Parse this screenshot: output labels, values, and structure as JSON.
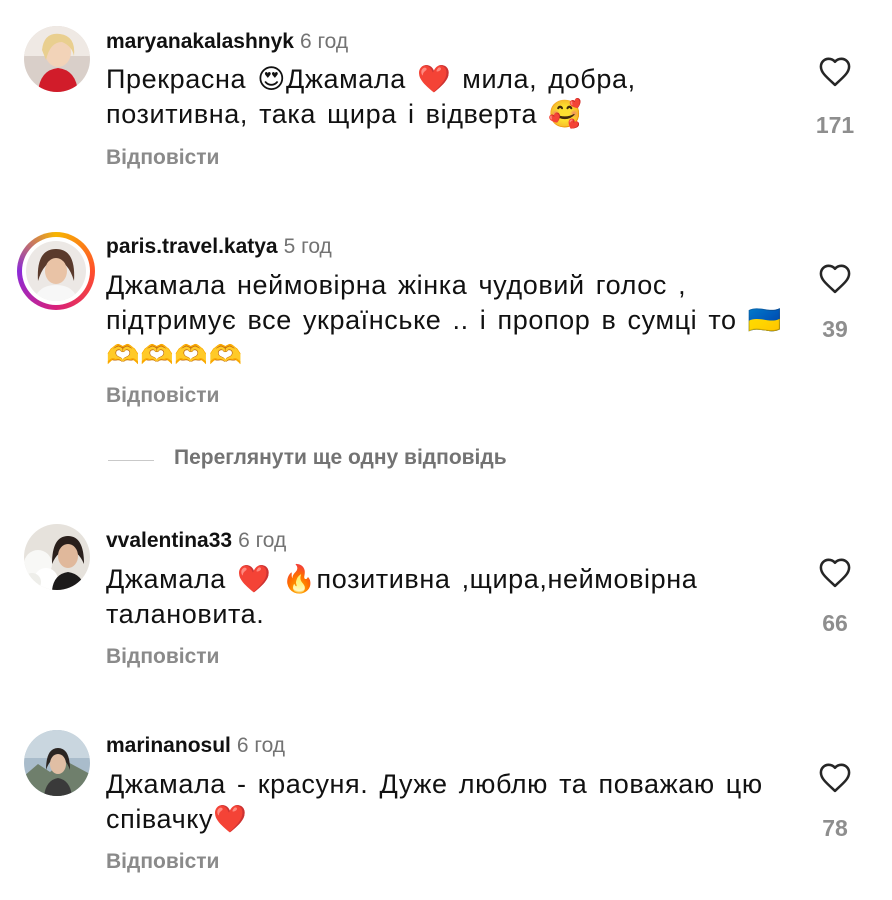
{
  "colors": {
    "background": "#ffffff",
    "username": "#111111",
    "meta": "#737373",
    "reply": "#8a8a8a",
    "like_count": "#8e8e8e",
    "heart_emoji": "#e0202f",
    "story_ring": [
      "#f7b500",
      "#ff4f2b",
      "#d8207a",
      "#8b2bd8"
    ]
  },
  "icons": {
    "like": "heart-outline-icon",
    "avatar": "profile-photo"
  },
  "comments": [
    {
      "username": "maryanakalashnyk",
      "time": "6 год",
      "text": "Прекрасна 😍Джамала ❤️ мила, добра, позитивна, така щира і відверта 🥰",
      "reply_label": "Відповісти",
      "likes": "171"
    },
    {
      "username": "paris.travel.katya",
      "time": "5 год",
      "text": "Джамала  неймовірна жінка чудовий голос , підтримує все українське .. і пропор в сумці то 🇺🇦 🫶🫶🫶🫶",
      "reply_label": "Відповісти",
      "likes": "39",
      "has_story_ring": true
    },
    {
      "username": "vvalentina33",
      "time": "6 год",
      "text": "Джамала ❤️ 🔥позитивна ,щира,неймовірна талановита.",
      "reply_label": "Відповісти",
      "likes": "66"
    },
    {
      "username": "marinanosul",
      "time": "6 год",
      "text": "Джамала - красуня. Дуже люблю та поважаю цю співачку❤️",
      "reply_label": "Відповісти",
      "likes": "78"
    }
  ],
  "view_more_replies": "Переглянути ще одну відповідь"
}
